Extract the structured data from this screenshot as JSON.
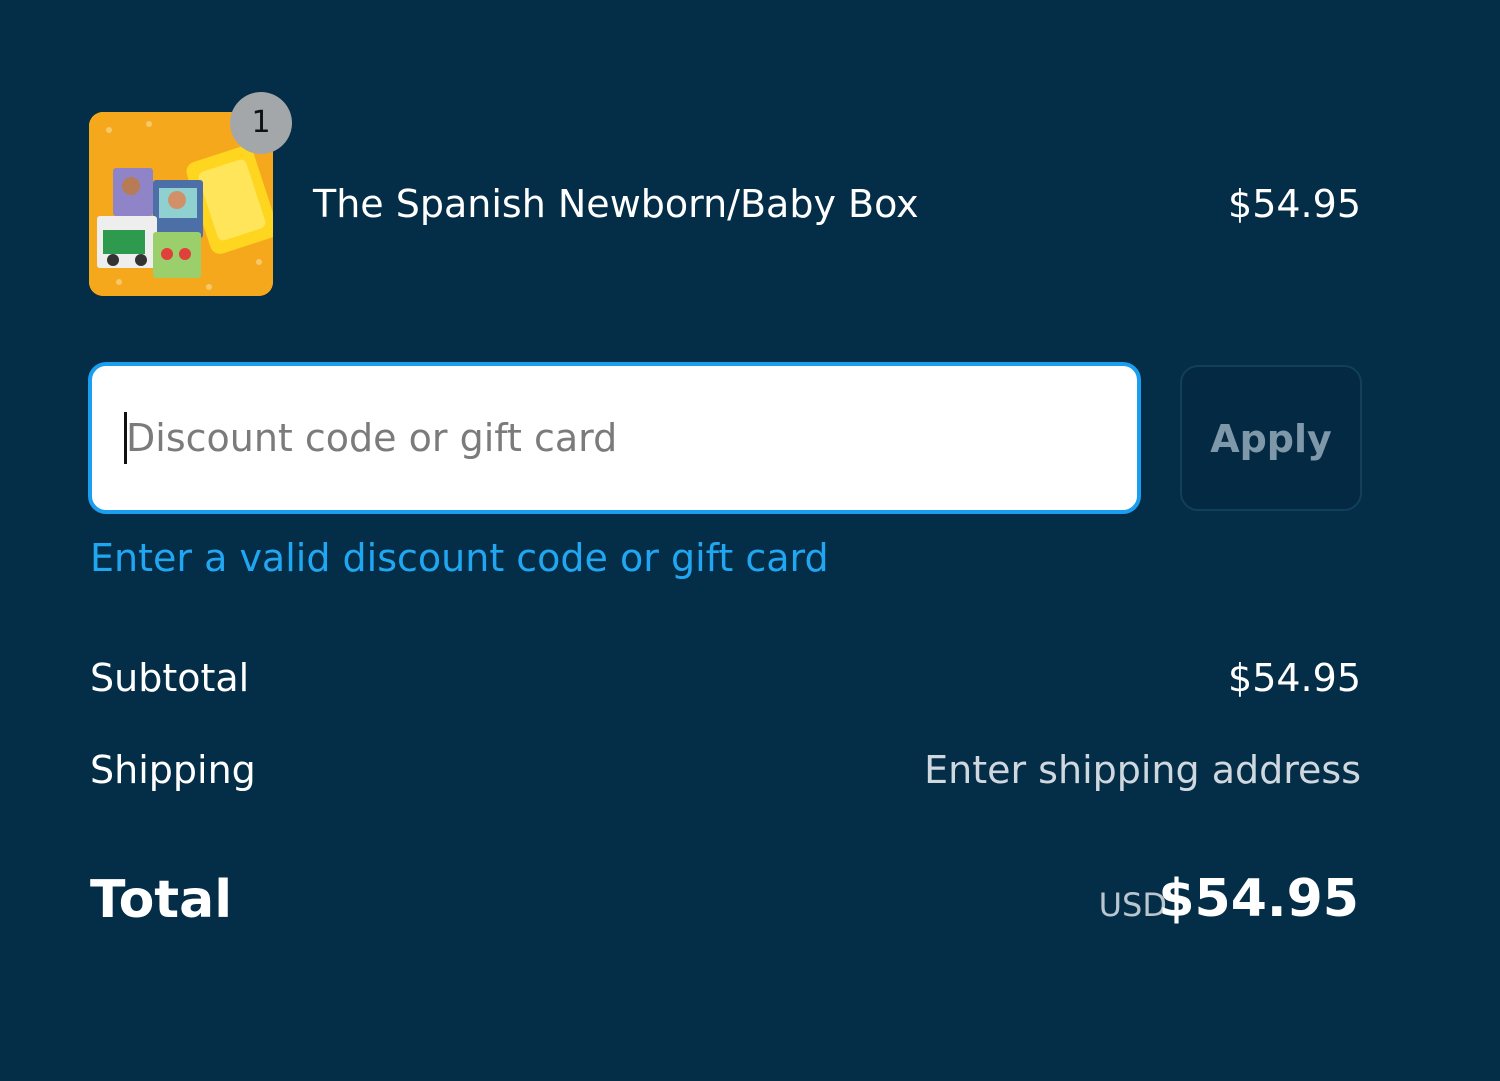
{
  "product": {
    "title": "The Spanish Newborn/Baby Box",
    "price": "$54.95",
    "quantity": "1",
    "thumbnail_icon": "baby-box-product-image"
  },
  "discount": {
    "placeholder": "Discount code or gift card",
    "value": "",
    "apply_label": "Apply",
    "error": "Enter a valid discount code or gift card"
  },
  "totals": {
    "subtotal_label": "Subtotal",
    "subtotal_value": "$54.95",
    "shipping_label": "Shipping",
    "shipping_value": "Enter shipping address",
    "total_label": "Total",
    "currency": "USD",
    "total_value": "$54.95"
  },
  "colors": {
    "background": "#042d47",
    "accent": "#1b9ef0",
    "error_text": "#21a7f2"
  }
}
